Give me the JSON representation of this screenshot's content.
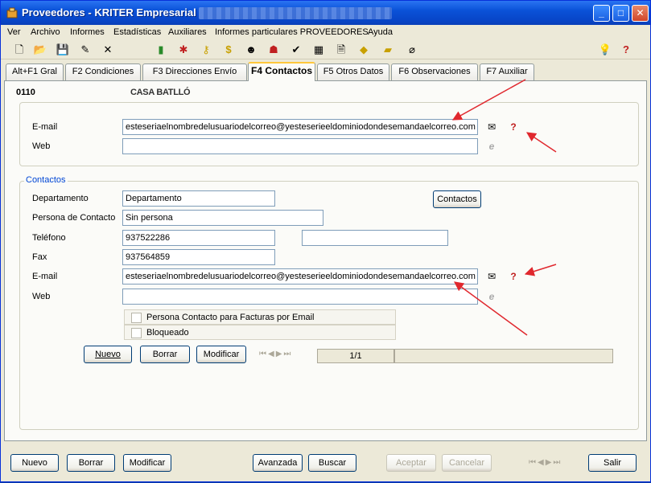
{
  "window": {
    "title": "Proveedores - KRITER Empresarial",
    "controls": {
      "minimize": "_",
      "maximize": "□",
      "close": "✕"
    }
  },
  "menu": [
    "Ver",
    "Archivo",
    "Informes",
    "Estadísticas",
    "Auxiliares",
    "Informes particulares PROVEEDORES",
    "Ayuda"
  ],
  "toolbar_icons": [
    "new-document-icon",
    "open-folder-icon",
    "save-icon",
    "edit-icon",
    "delete-icon",
    "bottle-icon",
    "star-icon",
    "lock-icon",
    "dollar-icon",
    "user-icon",
    "people-icon",
    "checklist-icon",
    "table-icon",
    "document-icon",
    "tag-icon",
    "note-icon",
    "paperclip-icon",
    "lightbulb-icon",
    "help-icon"
  ],
  "tabs": [
    "Alt+F1 Gral",
    "F2 Condiciones",
    "F3 Direcciones Envío",
    "F4 Contactos",
    "F5 Otros Datos",
    "F6 Observaciones",
    "F7 Auxiliar"
  ],
  "active_tab": "F4 Contactos",
  "supplier": {
    "code": "0110",
    "name": "CASA BATLLÓ"
  },
  "general": {
    "email_label": "E-mail",
    "email_value": "esteseriaelnombredelusuariodelcorreo@yesteserieeldominiodondesemandaelcorreo.com",
    "web_label": "Web",
    "web_value": ""
  },
  "contactos": {
    "legend": "Contactos",
    "departamento_label": "Departamento",
    "departamento_value": "Departamento",
    "contactos_button": "Contactos",
    "persona_label": "Persona de Contacto",
    "persona_value": "Sin persona",
    "telefono_label": "Teléfono",
    "telefono_value": "937522286",
    "telefono2_value": "",
    "fax_label": "Fax",
    "fax_value": "937564859",
    "email_label": "E-mail",
    "email_value": "esteseriaelnombredelusuariodelcorreo@yesteserieeldominiodondesemandaelcorreo.com",
    "web_label": "Web",
    "web_value": "",
    "check_facturas": "Persona Contacto para Facturas por Email",
    "check_bloqueado": "Bloqueado",
    "btn_nuevo": "Nuevo",
    "btn_borrar": "Borrar",
    "btn_modificar": "Modificar",
    "record_counter": "1/1"
  },
  "footer": {
    "nuevo": "Nuevo",
    "borrar": "Borrar",
    "modificar": "Modificar",
    "avanzada": "Avanzada",
    "buscar": "Buscar",
    "aceptar": "Aceptar",
    "cancelar": "Cancelar",
    "salir": "Salir"
  },
  "colors": {
    "arrow": "#e0282e",
    "title_bar": "#0a52d8",
    "active_tab_accent": "#ffc83c",
    "legend_text": "#0046d5"
  }
}
